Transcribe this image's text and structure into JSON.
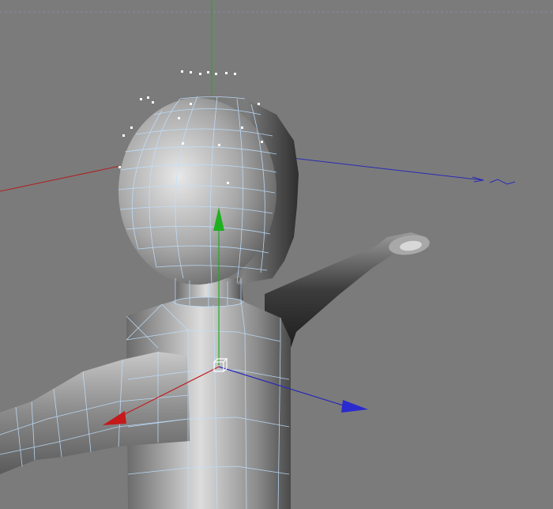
{
  "viewport": {
    "background": "#7b7b7b",
    "model_fill": "#9a9a9a",
    "wireframe_color": "#bfe0ff",
    "vertex_color": "#ffffff"
  },
  "axes": {
    "world": {
      "x_color": "#b02020",
      "y_color": "#22aa22",
      "z_color": "#2a2ab8",
      "horizon_color": "#8a8aaa"
    },
    "gizmo": {
      "x_icon": "red-arrow-icon",
      "y_icon": "green-arrow-icon",
      "z_icon": "blue-arrow-icon",
      "center_icon": "cube-icon"
    }
  },
  "object": {
    "type": "character-mesh",
    "selected_parts": [
      "head",
      "torso",
      "left-arm"
    ]
  }
}
